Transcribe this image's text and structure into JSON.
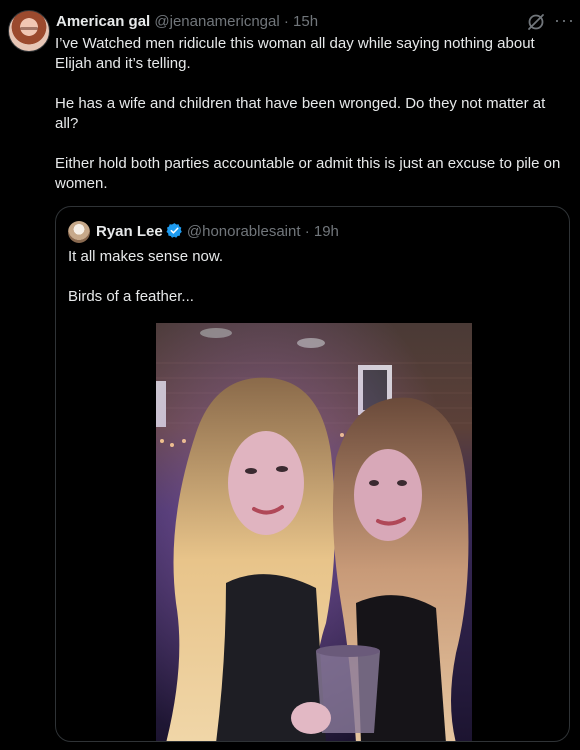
{
  "tweet": {
    "author_name": "American gal",
    "author_handle": "@jenanamericngal",
    "separator": "·",
    "time": "15h",
    "more_label": "···",
    "text": "I’ve Watched men ridicule this woman all day while saying nothing about Elijah and it’s telling.\n\n He has a wife and children that have been wronged. Do they not matter at all?\n\nEither hold both parties accountable or admit this is just an excuse to pile on women."
  },
  "quoted": {
    "author_name": "Ryan Lee",
    "author_handle": "@honorablesaint",
    "separator": "·",
    "time": "19h",
    "text": "It all makes sense now.\n\nBirds of a feather...",
    "verified_color": "#1d9bf0"
  },
  "icons": {
    "grok": "grok-slash-icon",
    "more": "more-icon",
    "verified": "verified-badge-icon"
  }
}
